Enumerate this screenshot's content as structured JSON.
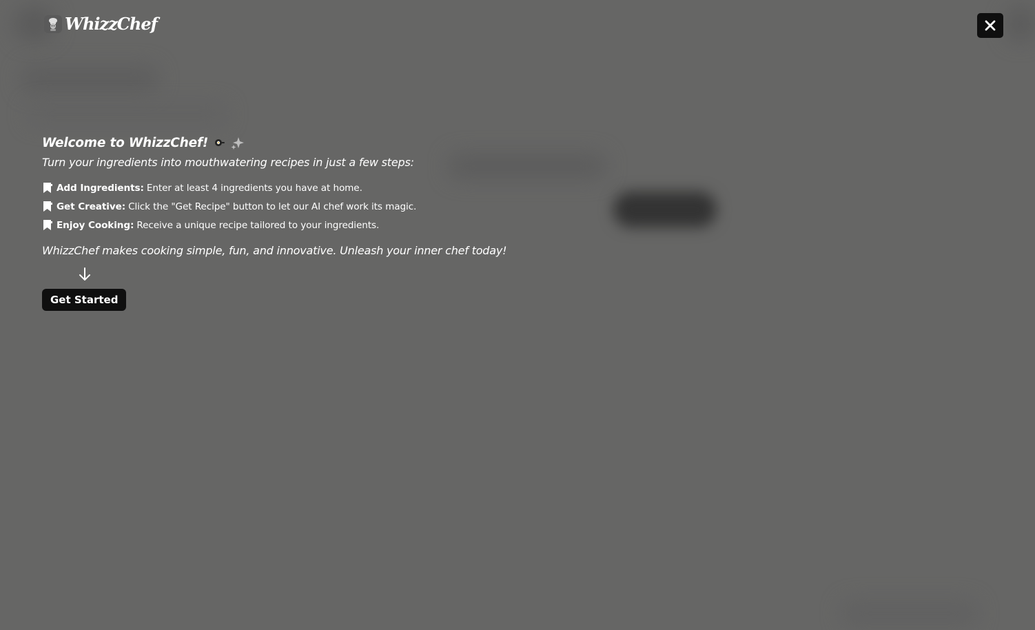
{
  "header": {
    "logo_text": "WhizzChef",
    "close_icon": "close-icon"
  },
  "welcome": {
    "title": "Welcome to WhizzChef!",
    "subtitle": "Turn your ingredients into mouthwatering recipes in just a few steps:",
    "steps": [
      {
        "title": "Add Ingredients:",
        "text": "Enter at least 4 ingredients you have at home."
      },
      {
        "title": "Get Creative:",
        "text": "Click the \"Get Recipe\" button to let our AI chef work its magic."
      },
      {
        "title": "Enjoy Cooking:",
        "text": "Receive a unique recipe tailored to your ingredients."
      }
    ],
    "tagline": "WhizzChef makes cooking simple, fun, and innovative. Unleash your inner chef today!",
    "button_label": "Get Started"
  },
  "colors": {
    "overlay": "#666665",
    "button_bg": "#0f0f0f",
    "text": "#ffffff"
  }
}
